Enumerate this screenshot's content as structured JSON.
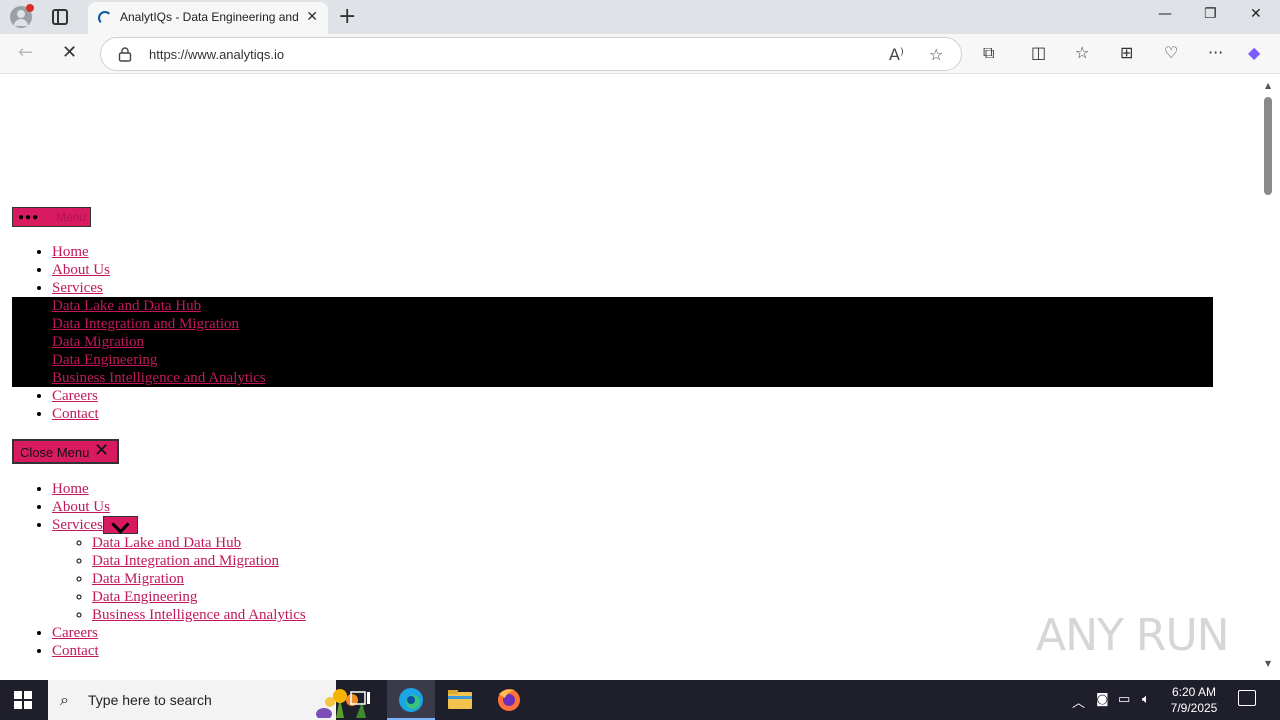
{
  "browser": {
    "tab_title": "AnalytIQs - Data Engineering and",
    "url": "https://www.analytiqs.io"
  },
  "page": {
    "menu_button_label": "Menu",
    "nav_items": [
      "Home",
      "About Us",
      "Services",
      "Careers",
      "Contact"
    ],
    "services_items": [
      "Data Lake and Data Hub",
      "Data Integration and Migration",
      "Data Migration",
      "Data Engineering",
      "Business Intelligence and Analytics"
    ],
    "close_menu_label": "Close Menu",
    "watermark": "ANY RUN"
  },
  "taskbar": {
    "search_placeholder": "Type here to search",
    "time": "6:20 AM",
    "date": "7/9/2025"
  },
  "colors": {
    "link": "#c2185b",
    "button_bg": "#d81b60",
    "submenu_bg": "#000000"
  }
}
